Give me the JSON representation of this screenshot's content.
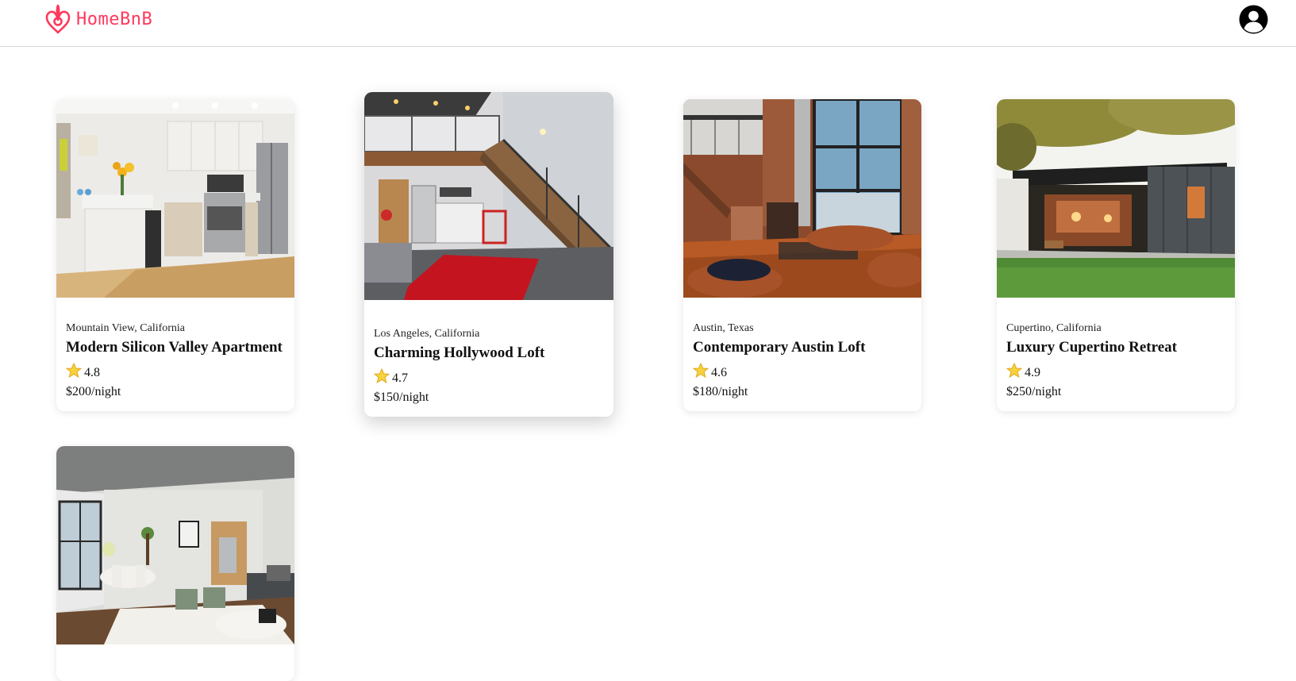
{
  "app": {
    "brand": "HomeBnB",
    "brand_color": "#FF385C"
  },
  "header": {
    "logo_icon": "airbnb-logo-icon",
    "user_icon": "user-avatar-icon"
  },
  "listings": [
    {
      "location": "Mountain View, California",
      "title": "Modern Silicon Valley Apartment",
      "rating": "4.8",
      "price": "$200/night"
    },
    {
      "location": "Los Angeles, California",
      "title": "Charming Hollywood Loft",
      "rating": "4.7",
      "price": "$150/night"
    },
    {
      "location": "Austin, Texas",
      "title": "Contemporary Austin Loft",
      "rating": "4.6",
      "price": "$180/night"
    },
    {
      "location": "Cupertino, California",
      "title": "Luxury Cupertino Retreat",
      "rating": "4.9",
      "price": "$250/night"
    },
    {
      "location": "",
      "title": "",
      "rating": "",
      "price": ""
    }
  ],
  "star_icon": "star-icon"
}
